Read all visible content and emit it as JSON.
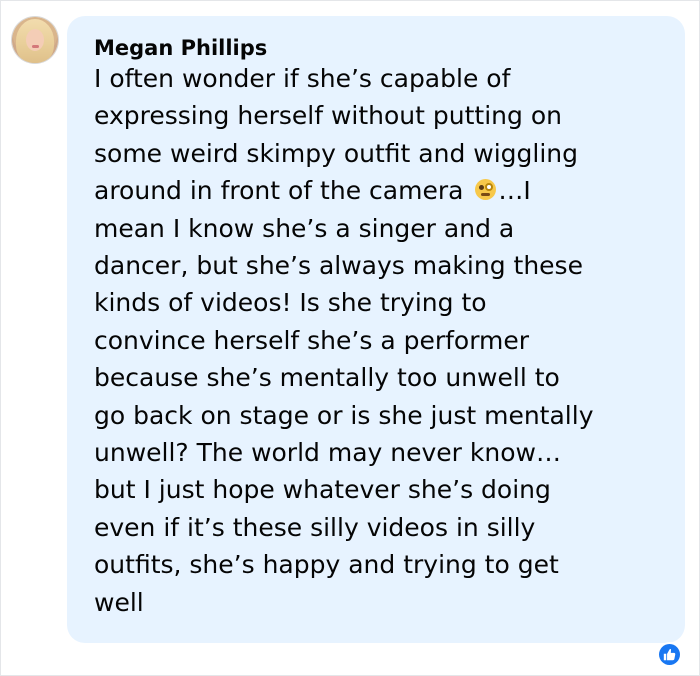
{
  "comment": {
    "author": "Megan Phillips",
    "avatar_icon": "profile-photo",
    "lines": [
      "I often wonder if she’s capable of",
      "expressing herself without putting on",
      "some weird skimpy outfit and wiggling",
      "around in front of the camera ",
      "…I",
      "mean I know she’s a singer and a",
      "dancer, but she’s always making these",
      "kinds of videos! Is she trying to",
      "convince herself she’s a performer",
      "because she’s mentally too unwell to",
      "go back on stage or is she just mentally",
      "unwell? The world may never know…",
      "but I just hope whatever she’s doing",
      "even if it’s these silly videos in silly",
      "outfits, she’s happy and trying to get",
      "well"
    ],
    "emoji_icon": "face-with-monocle-emoji",
    "reaction_icon": "like-thumbs-up-icon",
    "colors": {
      "bubble": "#e7f3ff",
      "text": "#050505",
      "like": "#1877f2"
    }
  }
}
